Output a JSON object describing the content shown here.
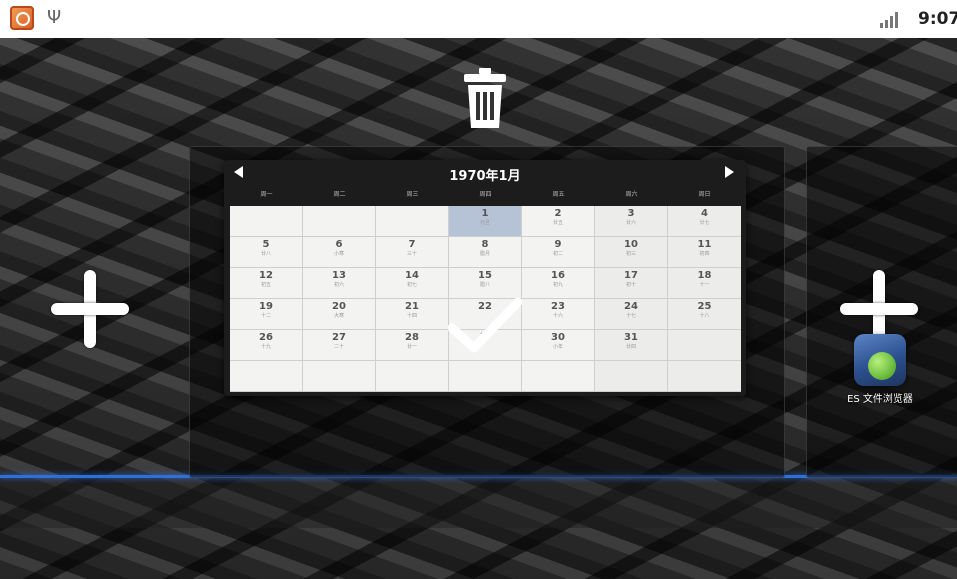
{
  "status_bar": {
    "time": "9:07",
    "icons": [
      "app-notification-icon",
      "usb-icon",
      "signal-icon"
    ],
    "usb_glyph": "Ψ"
  },
  "trash": {
    "icon": "trash-icon"
  },
  "calendar": {
    "title": "1970年1月",
    "weekdays": [
      "周一",
      "周二",
      "周三",
      "周四",
      "周五",
      "周六",
      "周日"
    ],
    "today": "1",
    "weeks": [
      [
        {
          "day": "",
          "lunar": ""
        },
        {
          "day": "",
          "lunar": ""
        },
        {
          "day": "",
          "lunar": ""
        },
        {
          "day": "1",
          "lunar": "元旦"
        },
        {
          "day": "2",
          "lunar": "廿五"
        },
        {
          "day": "3",
          "lunar": "廿六"
        },
        {
          "day": "4",
          "lunar": "廿七"
        }
      ],
      [
        {
          "day": "5",
          "lunar": "廿八"
        },
        {
          "day": "6",
          "lunar": "小寒"
        },
        {
          "day": "7",
          "lunar": "三十"
        },
        {
          "day": "8",
          "lunar": "腊月"
        },
        {
          "day": "9",
          "lunar": "初二"
        },
        {
          "day": "10",
          "lunar": "初三"
        },
        {
          "day": "11",
          "lunar": "初四"
        }
      ],
      [
        {
          "day": "12",
          "lunar": "初五"
        },
        {
          "day": "13",
          "lunar": "初六"
        },
        {
          "day": "14",
          "lunar": "初七"
        },
        {
          "day": "15",
          "lunar": "腊八"
        },
        {
          "day": "16",
          "lunar": "初九"
        },
        {
          "day": "17",
          "lunar": "初十"
        },
        {
          "day": "18",
          "lunar": "十一"
        }
      ],
      [
        {
          "day": "19",
          "lunar": "十二"
        },
        {
          "day": "20",
          "lunar": "大寒"
        },
        {
          "day": "21",
          "lunar": "十四"
        },
        {
          "day": "22",
          "lunar": ""
        },
        {
          "day": "23",
          "lunar": "十六"
        },
        {
          "day": "24",
          "lunar": "十七"
        },
        {
          "day": "25",
          "lunar": "十八"
        }
      ],
      [
        {
          "day": "26",
          "lunar": "十九"
        },
        {
          "day": "27",
          "lunar": "二十"
        },
        {
          "day": "28",
          "lunar": "廿一"
        },
        {
          "day": "",
          "lunar": "廿二"
        },
        {
          "day": "30",
          "lunar": "小年"
        },
        {
          "day": "31",
          "lunar": "廿四"
        },
        {
          "day": "",
          "lunar": ""
        }
      ],
      [
        {
          "day": "",
          "lunar": ""
        },
        {
          "day": "",
          "lunar": ""
        },
        {
          "day": "",
          "lunar": ""
        },
        {
          "day": "",
          "lunar": ""
        },
        {
          "day": "",
          "lunar": ""
        },
        {
          "day": "",
          "lunar": ""
        },
        {
          "day": "",
          "lunar": ""
        }
      ]
    ]
  },
  "apps": [
    {
      "label": "ES 文件浏览器",
      "icon": "es-file-explorer-icon"
    }
  ],
  "colors": {
    "accent_line": "#2f6fd8",
    "today_cell": "#b6c2d6"
  }
}
